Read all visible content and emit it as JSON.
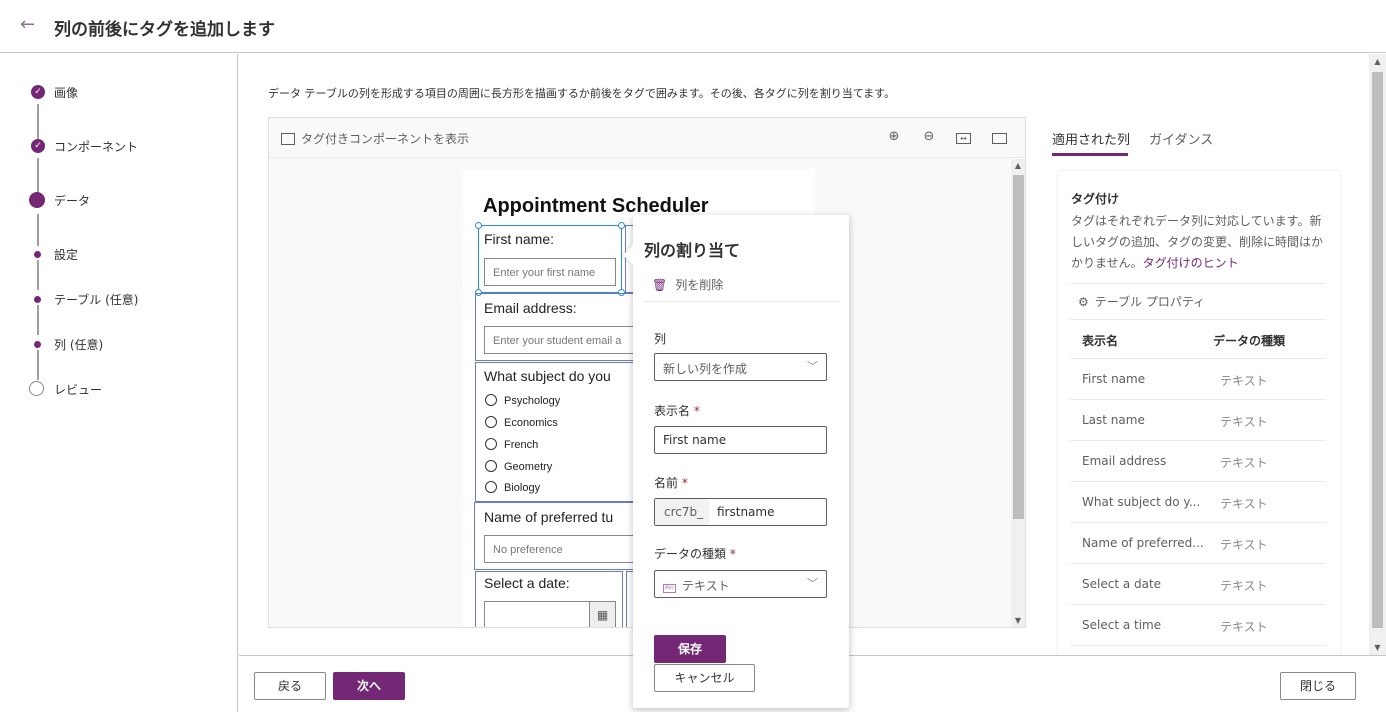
{
  "header": {
    "back_icon": "←",
    "title": "列の前後にタグを追加します"
  },
  "stepper": {
    "steps": [
      {
        "label": "画像",
        "state": "completed"
      },
      {
        "label": "コンポーネント",
        "state": "completed"
      },
      {
        "label": "データ",
        "state": "current"
      },
      {
        "label": "設定",
        "state": "substep"
      },
      {
        "label": "テーブル (任意)",
        "state": "substep"
      },
      {
        "label": "列 (任意)",
        "state": "substep"
      },
      {
        "label": "レビュー",
        "state": "pending"
      }
    ],
    "check_glyph": "✓"
  },
  "main": {
    "description": "データ テーブルの列を形成する項目の周囲に長方形を描画するか前後をタグで囲みます。その後、各タグに列を割り当てます。",
    "canvas": {
      "toolbar": {
        "show_tagged_label": "タグ付きコンポーネントを表示",
        "zoom_in_icon": "⊕",
        "zoom_out_icon": "⊖",
        "fit_width_icon": "↔",
        "fit_page_icon": "⛶"
      },
      "scroll_up": "▲",
      "scroll_down": "▼",
      "form": {
        "title": "Appointment Scheduler",
        "first_name_label": "First name:",
        "first_name_placeholder": "Enter your first name",
        "email_label": "Email address:",
        "email_placeholder": "Enter your student email a",
        "subject_label": "What subject do you",
        "subjects": [
          "Psychology",
          "Economics",
          "French",
          "Geometry",
          "Biology"
        ],
        "tutor_label": "Name of preferred tu",
        "tutor_placeholder": "No preference",
        "date_label": "Select a date:",
        "calendar_icon": "▦"
      }
    }
  },
  "assign_popup": {
    "title": "列の割り当て",
    "delete_label": "列を削除",
    "trash_icon": "🗑",
    "column_label": "列",
    "column_value": "新しい列を作成",
    "display_name_label": "表示名",
    "display_name_value": "First name",
    "name_label": "名前",
    "name_prefix": "crc7b_",
    "name_value": "firstname",
    "data_type_label": "データの種類",
    "data_type_value": "テキスト",
    "data_type_icon": "Abc",
    "required_mark": "*",
    "chevron": "﹀",
    "save_label": "保存",
    "cancel_label": "キャンセル"
  },
  "right_panel": {
    "tabs": [
      {
        "label": "適用された列",
        "active": true
      },
      {
        "label": "ガイダンス",
        "active": false
      }
    ],
    "card": {
      "heading": "タグ付け",
      "text": "タグはそれぞれデータ列に対応しています。新しいタグの追加、タグの変更、削除に時間はかかりません。",
      "link": "タグ付けのヒント",
      "table_props_label": "テーブル プロパティ",
      "gear_icon": "⚙",
      "col_display_name": "表示名",
      "col_data_type": "データの種類",
      "rows": [
        {
          "name": "First name",
          "type": "テキスト"
        },
        {
          "name": "Last name",
          "type": "テキスト"
        },
        {
          "name": "Email address",
          "type": "テキスト"
        },
        {
          "name": "What subject do y...",
          "type": "テキスト"
        },
        {
          "name": "Name of preferred...",
          "type": "テキスト"
        },
        {
          "name": "Select a date",
          "type": "テキスト"
        },
        {
          "name": "Select a time",
          "type": "テキスト"
        }
      ]
    }
  },
  "footer": {
    "back_label": "戻る",
    "next_label": "次へ",
    "close_label": "閉じる"
  },
  "colors": {
    "accent": "#742774",
    "tag_border": "#6b7bc4",
    "selected_tag": "#2b88d8"
  }
}
